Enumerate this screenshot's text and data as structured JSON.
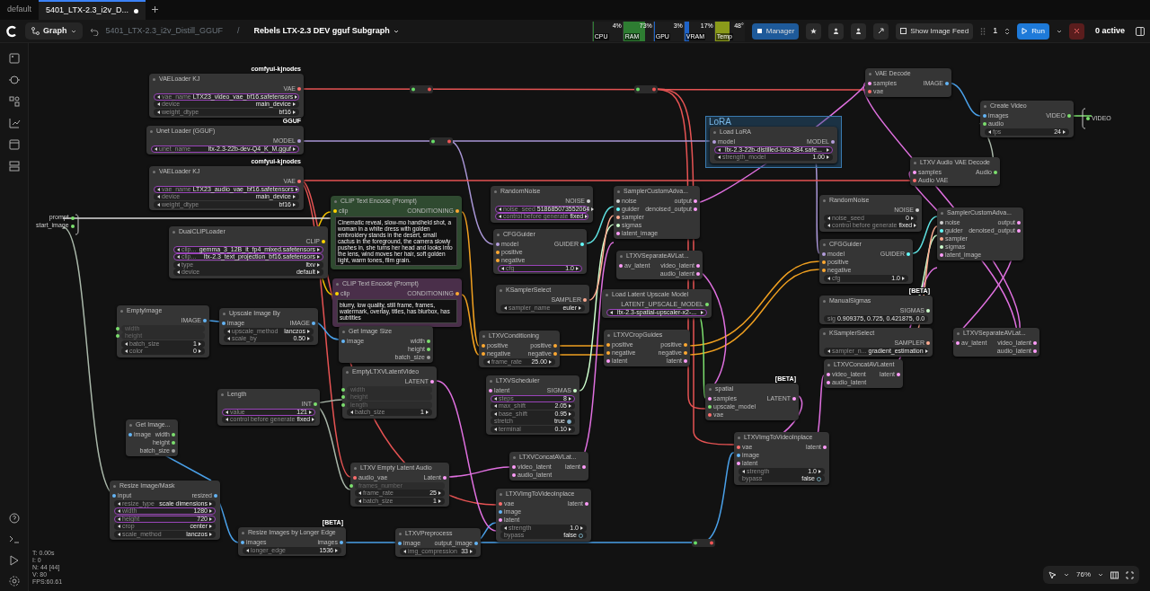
{
  "tabs": [
    {
      "label": "default",
      "selected": false,
      "unsaved": false
    },
    {
      "label": "5401_LTX-2.3_i2v_D...",
      "selected": true,
      "unsaved": true
    }
  ],
  "toolbar": {
    "mode": "Graph",
    "breadcrumb": "5401_LTX-2.3_i2v_Distill_GGUF",
    "separator": "/",
    "subgraph": "Rebels LTX-2.3 DEV gguf Subgraph",
    "monitors": [
      {
        "label": "CPU",
        "reading": "4%",
        "level": 0.04,
        "color": "#2e7d32"
      },
      {
        "label": "RAM",
        "reading": "73%",
        "level": 0.73,
        "color": "#2e7d32"
      },
      {
        "label": "GPU",
        "reading": "3%",
        "level": 0.03,
        "color": "#1e63c8"
      },
      {
        "label": "VRAM",
        "reading": "17%",
        "level": 0.17,
        "color": "#1e63c8"
      },
      {
        "label": "Temp",
        "reading": "48°",
        "level": 0.48,
        "color": "#8a9a1a"
      }
    ],
    "manager": "Manager",
    "image_feed": "Show Image Feed",
    "batch": "1",
    "run": "Run",
    "queue": "0 active"
  },
  "subgraph_inputs": [
    {
      "label": "prompt",
      "color": "#7cdf6e"
    },
    {
      "label": "start_image",
      "color": "#7cdf6e"
    }
  ],
  "subgraph_outputs": [
    {
      "label": "VIDEO",
      "color": "#7cdf6e"
    }
  ],
  "groups": [
    {
      "title": "LoRA"
    }
  ],
  "nodes": [
    {
      "title": "VAELoader KJ",
      "badge": "comfyui-kjnodes",
      "outputs": [
        {
          "label": "VAE",
          "color": "#ff6e6e"
        }
      ],
      "widgets": [
        {
          "label": "vae_name",
          "value": "LTX23_video_vae_bf16.safetensors",
          "kind": "combo",
          "promoted": true
        },
        {
          "label": "device",
          "value": "main_device",
          "kind": "combo",
          "promoted": false
        },
        {
          "label": "weight_dtype",
          "value": "bf16",
          "kind": "combo",
          "promoted": false
        }
      ]
    },
    {
      "title": "Unet Loader (GGUF)",
      "badge": "GGUF",
      "outputs": [
        {
          "label": "MODEL",
          "color": "#b39ddb"
        }
      ],
      "widgets": [
        {
          "label": "unet_name",
          "value": "ltx-2.3-22b-dev-Q4_K_M.gguf",
          "kind": "combo",
          "promoted": true
        }
      ]
    },
    {
      "title": "VAELoader KJ",
      "badge": "comfyui-kjnodes",
      "outputs": [
        {
          "label": "VAE",
          "color": "#ff6e6e"
        }
      ],
      "widgets": [
        {
          "label": "vae_name",
          "value": "LTX23_audio_vae_bf16.safetensors",
          "kind": "combo",
          "promoted": true
        },
        {
          "label": "device",
          "value": "main_device",
          "kind": "combo",
          "promoted": false
        },
        {
          "label": "weight_dtype",
          "value": "bf16",
          "kind": "combo",
          "promoted": false
        }
      ]
    },
    {
      "title": "DualCLIPLoader",
      "outputs": [
        {
          "label": "CLIP",
          "color": "#ffd500"
        }
      ],
      "widgets": [
        {
          "label": "clip...",
          "value": "gemma_3_12B_it_fp4_mixed.safetensors",
          "kind": "combo",
          "promoted": true
        },
        {
          "label": "clip...",
          "value": "ltx-2.3_text_projection_bf16.safetensors",
          "kind": "combo",
          "promoted": true
        },
        {
          "label": "type",
          "value": "ltxv",
          "kind": "combo",
          "promoted": false
        },
        {
          "label": "device",
          "value": "default",
          "kind": "combo",
          "promoted": false
        }
      ]
    },
    {
      "title": "CLIP Text Encode (Prompt)",
      "color": "#2f4a30",
      "inputs": [
        {
          "label": "clip",
          "color": "#ffd500"
        }
      ],
      "outputs": [
        {
          "label": "CONDITIONING",
          "color": "#ffa931"
        }
      ],
      "prompt": "Cinematic reveal, slow-mo handheld shot, a woman in a white dress with golden embroidery stands in the desert, small cactus in the foreground, the camera slowly pushes in, she turns her head and looks into the lens, wind moves her hair, soft golden light, warm tones, film grain."
    },
    {
      "title": "CLIP Text Encode (Prompt)",
      "color": "#4a2f4a",
      "inputs": [
        {
          "label": "clip",
          "color": "#ffd500"
        }
      ],
      "outputs": [
        {
          "label": "CONDITIONING",
          "color": "#ffa931"
        }
      ],
      "prompt": "blurry, low quality, still frame, frames, watermark, overlay, titles, has blurbox, has subtitles"
    },
    {
      "title": "EmptyImage",
      "outputs": [
        {
          "label": "IMAGE",
          "color": "#64b5f6"
        }
      ],
      "widgets": [
        {
          "label": "width",
          "kind": "converted",
          "color": "#7cdf6e",
          "promoted": false
        },
        {
          "label": "height",
          "kind": "converted",
          "color": "#7cdf6e",
          "promoted": false
        },
        {
          "label": "batch_size",
          "value": "1",
          "kind": "number",
          "promoted": false
        },
        {
          "label": "color",
          "value": "0",
          "kind": "number",
          "promoted": false
        }
      ]
    },
    {
      "title": "Upscale Image By",
      "inputs": [
        {
          "label": "image",
          "color": "#64b5f6"
        }
      ],
      "outputs": [
        {
          "label": "IMAGE",
          "color": "#64b5f6"
        }
      ],
      "widgets": [
        {
          "label": "upscale_method",
          "value": "lanczos",
          "kind": "combo",
          "promoted": false
        },
        {
          "label": "scale_by",
          "value": "0.50",
          "kind": "number",
          "promoted": false
        }
      ]
    },
    {
      "title": "Get Image Size",
      "inputs": [
        {
          "label": "image",
          "color": "#64b5f6"
        }
      ],
      "outputs": [
        {
          "label": "width",
          "color": "#7cdf6e"
        },
        {
          "label": "height",
          "color": "#7cdf6e"
        },
        {
          "label": "batch_size",
          "color": "#9e9e9e"
        }
      ]
    },
    {
      "title": "EmptyLTXVLatentVideo",
      "outputs": [
        {
          "label": "LATENT",
          "color": "#ff9cf9"
        }
      ],
      "widgets": [
        {
          "label": "width",
          "kind": "converted",
          "color": "#7cdf6e",
          "promoted": false
        },
        {
          "label": "height",
          "kind": "converted",
          "color": "#7cdf6e",
          "promoted": false
        },
        {
          "label": "length",
          "kind": "converted",
          "color": "#7cdf6e",
          "promoted": false
        },
        {
          "label": "batch_size",
          "value": "1",
          "kind": "number",
          "promoted": false
        }
      ]
    },
    {
      "title": "Length",
      "outputs": [
        {
          "label": "INT",
          "color": "#7cdf6e"
        }
      ],
      "widgets": [
        {
          "label": "value",
          "value": "121",
          "kind": "number",
          "promoted": true
        },
        {
          "label": "control before generate",
          "value": "fixed",
          "kind": "combo",
          "promoted": false
        }
      ]
    },
    {
      "title": "Get Image...",
      "inputs": [
        {
          "label": "image",
          "color": "#64b5f6"
        }
      ],
      "outputs": [
        {
          "label": "width",
          "color": "#7cdf6e"
        },
        {
          "label": "height",
          "color": "#7cdf6e"
        },
        {
          "label": "batch_size",
          "color": "#9e9e9e"
        }
      ]
    },
    {
      "title": "Resize Image/Mask",
      "inputs": [
        {
          "label": "input",
          "color": "#64b5f6"
        }
      ],
      "outputs": [
        {
          "label": "resized",
          "color": "#64b5f6"
        }
      ],
      "widgets": [
        {
          "label": "resize_type",
          "value": "scale dimensions",
          "kind": "combo",
          "promoted": false
        },
        {
          "label": "width",
          "value": "1280",
          "kind": "number",
          "promoted": true
        },
        {
          "label": "height",
          "value": "720",
          "kind": "number",
          "promoted": true
        },
        {
          "label": "crop",
          "value": "center",
          "kind": "combo",
          "promoted": false
        },
        {
          "label": "scale_method",
          "value": "lanczos",
          "kind": "combo",
          "promoted": false
        }
      ]
    },
    {
      "title": "Resize Images by Longer Edge",
      "badge": "[BETA]",
      "inputs": [
        {
          "label": "images",
          "color": "#64b5f6"
        }
      ],
      "outputs": [
        {
          "label": "images",
          "color": "#64b5f6"
        }
      ],
      "widgets": [
        {
          "label": "longer_edge",
          "value": "1536",
          "kind": "number",
          "promoted": false
        }
      ]
    },
    {
      "title": "LTXV Empty Latent Audio",
      "inputs": [
        {
          "label": "audio_vae",
          "color": "#ff6e6e"
        }
      ],
      "outputs": [
        {
          "label": "Latent",
          "color": "#ff9cf9"
        }
      ],
      "widgets": [
        {
          "label": "frames_number",
          "kind": "converted",
          "color": "#7cdf6e",
          "promoted": false
        },
        {
          "label": "frame_rate",
          "value": "25",
          "kind": "number",
          "promoted": false
        },
        {
          "label": "batch_size",
          "value": "1",
          "kind": "number",
          "promoted": false
        }
      ]
    },
    {
      "title": "LTXVPreprocess",
      "inputs": [
        {
          "label": "image",
          "color": "#64b5f6"
        }
      ],
      "outputs": [
        {
          "label": "output_image",
          "color": "#64b5f6"
        }
      ],
      "widgets": [
        {
          "label": "img_compression",
          "value": "33",
          "kind": "number",
          "promoted": false
        }
      ]
    },
    {
      "title": "RandomNoise",
      "outputs": [
        {
          "label": "NOISE",
          "color": "#d0d0d0"
        }
      ],
      "widgets": [
        {
          "label": "noise_seed",
          "value": "518685073552064",
          "kind": "number",
          "promoted": true
        },
        {
          "label": "control before generate",
          "value": "fixed",
          "kind": "combo",
          "promoted": true
        }
      ]
    },
    {
      "title": "CFGGuider",
      "inputs": [
        {
          "label": "model",
          "color": "#b39ddb"
        },
        {
          "label": "positive",
          "color": "#ffa931"
        },
        {
          "label": "negative",
          "color": "#ffa931"
        }
      ],
      "outputs": [
        {
          "label": "GUIDER",
          "color": "#66ffff"
        }
      ],
      "widgets": [
        {
          "label": "cfg",
          "value": "1.0",
          "kind": "number",
          "promoted": true
        }
      ]
    },
    {
      "title": "KSamplerSelect",
      "outputs": [
        {
          "label": "SAMPLER",
          "color": "#ffab91"
        }
      ],
      "widgets": [
        {
          "label": "sampler_name",
          "value": "euler",
          "kind": "combo",
          "promoted": false
        }
      ]
    },
    {
      "title": "SamplerCustomAdva...",
      "inputs": [
        {
          "label": "noise",
          "color": "#d0d0d0"
        },
        {
          "label": "guider",
          "color": "#66ffff"
        },
        {
          "label": "sampler",
          "color": "#ffab91"
        },
        {
          "label": "sigmas",
          "color": "#cdffcd"
        },
        {
          "label": "latent_image",
          "color": "#ff9cf9"
        }
      ],
      "outputs": [
        {
          "label": "output",
          "color": "#ff9cf9"
        },
        {
          "label": "denoised_output",
          "color": "#ff9cf9"
        }
      ]
    },
    {
      "title": "LTXVSeparateAVLat...",
      "inputs": [
        {
          "label": "av_latent",
          "color": "#ff9cf9"
        }
      ],
      "outputs": [
        {
          "label": "video_latent",
          "color": "#ff9cf9"
        },
        {
          "label": "audio_latent",
          "color": "#ff9cf9"
        }
      ]
    },
    {
      "title": "Load Latent Upscale Model",
      "outputs": [
        {
          "label": "LATENT_UPSCALE_MODEL",
          "color": "#7cdf6e"
        }
      ],
      "widgets": [
        {
          "value": "ltx-2.3-spatial-upscaler-x2-...",
          "kind": "combo",
          "promoted": true
        }
      ]
    },
    {
      "title": "LTXVConditioning",
      "inputs": [
        {
          "label": "positive",
          "color": "#ffa931"
        },
        {
          "label": "negative",
          "color": "#ffa931"
        }
      ],
      "outputs": [
        {
          "label": "positive",
          "color": "#ffa931"
        },
        {
          "label": "negative",
          "color": "#ffa931"
        }
      ],
      "widgets": [
        {
          "label": "frame_rate",
          "value": "25.00",
          "kind": "number",
          "promoted": false
        }
      ]
    },
    {
      "title": "LTXVCropGuides",
      "inputs": [
        {
          "label": "positive",
          "color": "#ffa931"
        },
        {
          "label": "negative",
          "color": "#ffa931"
        },
        {
          "label": "latent",
          "color": "#ff9cf9"
        }
      ],
      "outputs": [
        {
          "label": "positive",
          "color": "#ffa931"
        },
        {
          "label": "negative",
          "color": "#ffa931"
        },
        {
          "label": "latent",
          "color": "#ff9cf9"
        }
      ]
    },
    {
      "title": "LTXVScheduler",
      "inputs": [
        {
          "label": "latent",
          "color": "#ff9cf9"
        }
      ],
      "outputs": [
        {
          "label": "SIGMAS",
          "color": "#cdffcd"
        }
      ],
      "widgets": [
        {
          "label": "steps",
          "value": "8",
          "kind": "number",
          "promoted": true
        },
        {
          "label": "max_shift",
          "value": "2.05",
          "kind": "number",
          "promoted": false
        },
        {
          "label": "base_shift",
          "value": "0.95",
          "kind": "number",
          "promoted": false
        },
        {
          "label": "stretch",
          "value": "true",
          "kind": "toggle",
          "on": true,
          "promoted": false
        },
        {
          "label": "terminal",
          "value": "0.10",
          "kind": "number",
          "promoted": false
        }
      ]
    },
    {
      "title": "LTXVConcatAVLat...",
      "inputs": [
        {
          "label": "video_latent",
          "color": "#ff9cf9"
        },
        {
          "label": "audio_latent",
          "color": "#ff9cf9"
        }
      ],
      "outputs": [
        {
          "label": "latent",
          "color": "#ff9cf9"
        }
      ]
    },
    {
      "title": "LTXVImgToVideoInplace",
      "inputs": [
        {
          "label": "vae",
          "color": "#ff6e6e"
        },
        {
          "label": "image",
          "color": "#64b5f6"
        },
        {
          "label": "latent",
          "color": "#ff9cf9"
        }
      ],
      "outputs": [
        {
          "label": "latent",
          "color": "#ff9cf9"
        }
      ],
      "widgets": [
        {
          "label": "strength",
          "value": "1.0",
          "kind": "number",
          "promoted": false
        },
        {
          "label": "bypass",
          "value": "false",
          "kind": "toggle",
          "on": false,
          "promoted": false
        }
      ]
    },
    {
      "title": "Load LoRA",
      "inputs": [
        {
          "label": "model",
          "color": "#b39ddb"
        }
      ],
      "outputs": [
        {
          "label": "MODEL",
          "color": "#b39ddb"
        }
      ],
      "widgets": [
        {
          "value": "ltx-2.3-22b-distilled-lora-384.safe...",
          "kind": "combo",
          "promoted": true
        },
        {
          "label": "strength_model",
          "value": "1.00",
          "kind": "number",
          "promoted": false
        }
      ]
    },
    {
      "title": "VAE Decode",
      "inputs": [
        {
          "label": "samples",
          "color": "#ff9cf9"
        },
        {
          "label": "vae",
          "color": "#ff6e6e"
        }
      ],
      "outputs": [
        {
          "label": "IMAGE",
          "color": "#64b5f6"
        }
      ]
    },
    {
      "title": "Create Video",
      "inputs": [
        {
          "label": "images",
          "color": "#64b5f6"
        },
        {
          "label": "audio",
          "color": "#7cdf6e"
        }
      ],
      "outputs": [
        {
          "label": "VIDEO",
          "color": "#7cdf6e"
        }
      ],
      "widgets": [
        {
          "label": "fps",
          "value": "24",
          "kind": "number",
          "promoted": false
        }
      ]
    },
    {
      "title": "LTXV Audio VAE Decode",
      "inputs": [
        {
          "label": "samples",
          "color": "#ff9cf9"
        },
        {
          "label": "Audio VAE",
          "color": "#ff6e6e"
        }
      ],
      "outputs": [
        {
          "label": "Audio",
          "color": "#7cdf6e"
        }
      ]
    },
    {
      "title": "RandomNoise",
      "outputs": [
        {
          "label": "NOISE",
          "color": "#d0d0d0"
        }
      ],
      "widgets": [
        {
          "label": "noise_seed",
          "value": "0",
          "kind": "number",
          "promoted": false
        },
        {
          "label": "control before generate",
          "value": "fixed",
          "kind": "combo",
          "promoted": false
        }
      ]
    },
    {
      "title": "CFGGuider",
      "inputs": [
        {
          "label": "model",
          "color": "#b39ddb"
        },
        {
          "label": "positive",
          "color": "#ffa931"
        },
        {
          "label": "negative",
          "color": "#ffa931"
        }
      ],
      "outputs": [
        {
          "label": "GUIDER",
          "color": "#66ffff"
        }
      ],
      "widgets": [
        {
          "label": "cfg",
          "value": "1.0",
          "kind": "number",
          "promoted": false
        }
      ]
    },
    {
      "title": "ManualSigmas",
      "badge": "[BETA]",
      "outputs": [
        {
          "label": "SIGMAS",
          "color": "#cdffcd"
        }
      ],
      "widgets": [
        {
          "label": "sig",
          "value": "0.909375, 0.725, 0.421875, 0.0",
          "kind": "text",
          "promoted": false
        }
      ]
    },
    {
      "title": "KSamplerSelect",
      "outputs": [
        {
          "label": "SAMPLER",
          "color": "#ffab91"
        }
      ],
      "widgets": [
        {
          "label": "sampler_n...",
          "value": "gradient_estimation",
          "kind": "combo",
          "promoted": false
        }
      ]
    },
    {
      "title": "SamplerCustomAdva...",
      "inputs": [
        {
          "label": "noise",
          "color": "#d0d0d0"
        },
        {
          "label": "guider",
          "color": "#66ffff"
        },
        {
          "label": "sampler",
          "color": "#ffab91"
        },
        {
          "label": "sigmas",
          "color": "#cdffcd"
        },
        {
          "label": "latent_image",
          "color": "#ff9cf9"
        }
      ],
      "outputs": [
        {
          "label": "output",
          "color": "#ff9cf9"
        },
        {
          "label": "denoised_output",
          "color": "#ff9cf9"
        }
      ]
    },
    {
      "title": "LTXVSeparateAVLat...",
      "inputs": [
        {
          "label": "av_latent",
          "color": "#ff9cf9"
        }
      ],
      "outputs": [
        {
          "label": "video_latent",
          "color": "#ff9cf9"
        },
        {
          "label": "audio_latent",
          "color": "#ff9cf9"
        }
      ]
    },
    {
      "title": "LTXVConcatAVLatent",
      "inputs": [
        {
          "label": "video_latent",
          "color": "#ff9cf9"
        },
        {
          "label": "audio_latent",
          "color": "#ff9cf9"
        }
      ],
      "outputs": [
        {
          "label": "latent",
          "color": "#ff9cf9"
        }
      ]
    },
    {
      "title": "spatial",
      "badge": "[BETA]",
      "inputs": [
        {
          "label": "samples",
          "color": "#ff9cf9"
        },
        {
          "label": "upscale_model",
          "color": "#7cdf6e"
        },
        {
          "label": "vae",
          "color": "#ff6e6e"
        }
      ],
      "outputs": [
        {
          "label": "LATENT",
          "color": "#ff9cf9"
        }
      ]
    },
    {
      "title": "LTXVImgToVideoInplace",
      "inputs": [
        {
          "label": "vae",
          "color": "#ff6e6e"
        },
        {
          "label": "image",
          "color": "#64b5f6"
        },
        {
          "label": "latent",
          "color": "#ff9cf9"
        }
      ],
      "outputs": [
        {
          "label": "latent",
          "color": "#ff9cf9"
        }
      ],
      "widgets": [
        {
          "label": "strength",
          "value": "1.0",
          "kind": "number",
          "promoted": false
        },
        {
          "label": "bypass",
          "value": "false",
          "kind": "toggle",
          "on": false,
          "promoted": false
        }
      ]
    }
  ],
  "stats": [
    "T: 0.00s",
    "I: 0",
    "N: 44 [44]",
    "V: 80",
    "FPS:60.61"
  ],
  "zoom": "76%"
}
